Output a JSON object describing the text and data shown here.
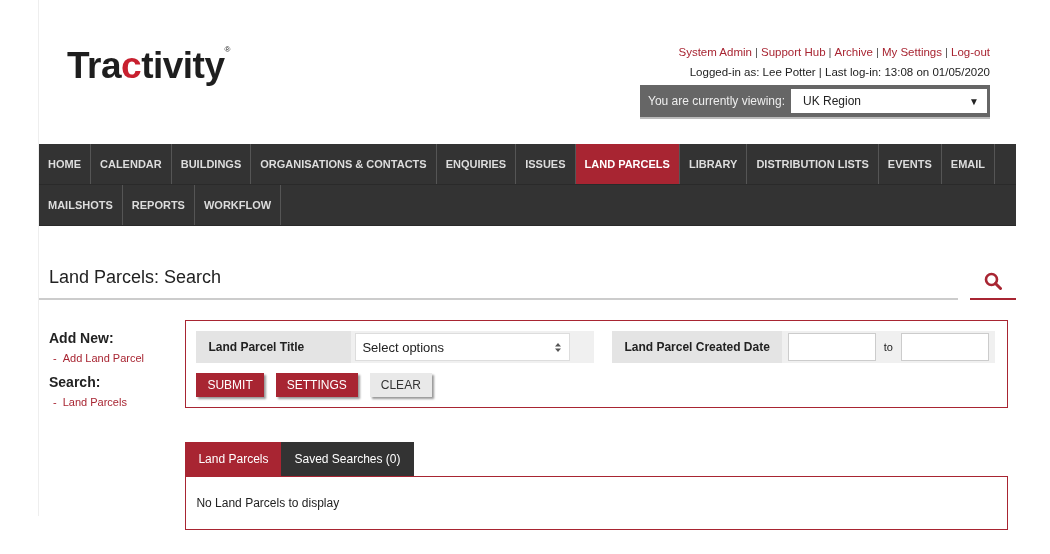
{
  "logo": {
    "start": "Tra",
    "accent": "c",
    "end": "tivity",
    "mark": "®"
  },
  "top_links": [
    "System Admin",
    "Support Hub",
    "Archive",
    "My Settings",
    "Log-out"
  ],
  "link_separator": "|",
  "login_info": "Logged-in as: Lee Potter | Last log-in: 13:08 on 01/05/2020",
  "viewing": {
    "label": "You are currently viewing:",
    "value": "UK Region",
    "caret": "▼"
  },
  "nav": [
    [
      {
        "label": "HOME",
        "selected": false
      },
      {
        "label": "CALENDAR",
        "selected": false
      },
      {
        "label": "BUILDINGS",
        "selected": false
      },
      {
        "label": "ORGANISATIONS & CONTACTS",
        "selected": false
      },
      {
        "label": "ENQUIRIES",
        "selected": false
      },
      {
        "label": "ISSUES",
        "selected": false
      },
      {
        "label": "LAND PARCELS",
        "selected": true
      },
      {
        "label": "LIBRARY",
        "selected": false
      },
      {
        "label": "DISTRIBUTION LISTS",
        "selected": false
      },
      {
        "label": "EVENTS",
        "selected": false
      },
      {
        "label": "EMAIL",
        "selected": false
      }
    ],
    [
      {
        "label": "MAILSHOTS",
        "selected": false
      },
      {
        "label": "REPORTS",
        "selected": false
      },
      {
        "label": "WORKFLOW",
        "selected": false
      }
    ]
  ],
  "page_title": "Land Parcels: Search",
  "sidebar_bullet": "-",
  "sidebar": [
    {
      "heading": "Add New:",
      "links": [
        "Add Land Parcel"
      ]
    },
    {
      "heading": "Search:",
      "links": [
        "Land Parcels"
      ]
    }
  ],
  "filters": {
    "title_label": "Land Parcel Title",
    "title_placeholder": "Select options",
    "date_label": "Land Parcel Created Date",
    "to_label": "to"
  },
  "buttons": [
    {
      "label": "SUBMIT",
      "kind": "primary"
    },
    {
      "label": "SETTINGS",
      "kind": "primary"
    },
    {
      "label": "CLEAR",
      "kind": "secondary"
    }
  ],
  "result_tabs": [
    {
      "label": "Land Parcels",
      "selected": true
    },
    {
      "label": "Saved Searches (0)",
      "selected": false
    }
  ],
  "empty_message": "No Land Parcels to display"
}
